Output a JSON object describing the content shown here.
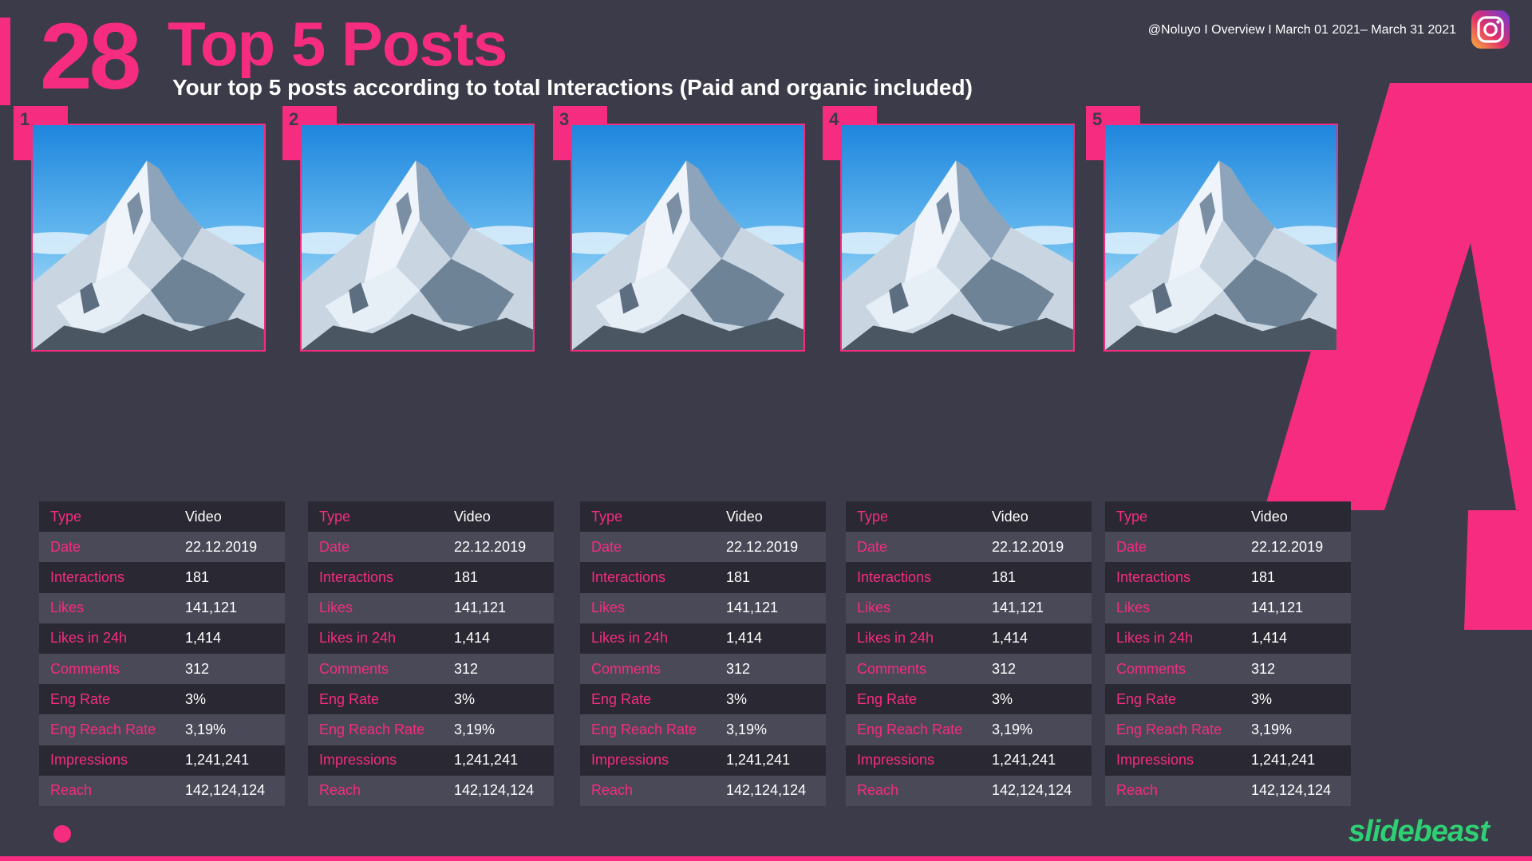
{
  "header": {
    "slide_number": "28",
    "title": "Top 5 Posts",
    "subtitle": "Your top 5 posts according to total Interactions (Paid and organic included)",
    "meta": "@Noluyo I Overview I March 01 2021– March 31 2021"
  },
  "colors": {
    "accent": "#f52c80",
    "background": "#3c3b49",
    "brand": "#2fcf74"
  },
  "icons": {
    "instagram": "instagram-icon"
  },
  "posts": [
    {
      "rank": "1",
      "rows": [
        {
          "label": "Type",
          "value": "Video"
        },
        {
          "label": "Date",
          "value": "22.12.2019"
        },
        {
          "label": "Interactions",
          "value": "181"
        },
        {
          "label": "Likes",
          "value": "141,121"
        },
        {
          "label": "Likes in 24h",
          "value": "1,414"
        },
        {
          "label": "Comments",
          "value": "312"
        },
        {
          "label": "Eng Rate",
          "value": "3%"
        },
        {
          "label": "Eng Reach Rate",
          "value": "3,19%"
        },
        {
          "label": "Impressions",
          "value": "1,241,241"
        },
        {
          "label": "Reach",
          "value": "142,124,124"
        }
      ]
    },
    {
      "rank": "2",
      "rows": [
        {
          "label": "Type",
          "value": "Video"
        },
        {
          "label": "Date",
          "value": "22.12.2019"
        },
        {
          "label": "Interactions",
          "value": "181"
        },
        {
          "label": "Likes",
          "value": "141,121"
        },
        {
          "label": "Likes in 24h",
          "value": "1,414"
        },
        {
          "label": "Comments",
          "value": "312"
        },
        {
          "label": "Eng Rate",
          "value": "3%"
        },
        {
          "label": "Eng Reach Rate",
          "value": "3,19%"
        },
        {
          "label": "Impressions",
          "value": "1,241,241"
        },
        {
          "label": "Reach",
          "value": "142,124,124"
        }
      ]
    },
    {
      "rank": "3",
      "rows": [
        {
          "label": "Type",
          "value": "Video"
        },
        {
          "label": "Date",
          "value": "22.12.2019"
        },
        {
          "label": "Interactions",
          "value": "181"
        },
        {
          "label": "Likes",
          "value": "141,121"
        },
        {
          "label": "Likes in 24h",
          "value": "1,414"
        },
        {
          "label": "Comments",
          "value": "312"
        },
        {
          "label": "Eng Rate",
          "value": "3%"
        },
        {
          "label": "Eng Reach Rate",
          "value": "3,19%"
        },
        {
          "label": "Impressions",
          "value": "1,241,241"
        },
        {
          "label": "Reach",
          "value": "142,124,124"
        }
      ]
    },
    {
      "rank": "4",
      "rows": [
        {
          "label": "Type",
          "value": "Video"
        },
        {
          "label": "Date",
          "value": "22.12.2019"
        },
        {
          "label": "Interactions",
          "value": "181"
        },
        {
          "label": "Likes",
          "value": "141,121"
        },
        {
          "label": "Likes in 24h",
          "value": "1,414"
        },
        {
          "label": "Comments",
          "value": "312"
        },
        {
          "label": "Eng Rate",
          "value": "3%"
        },
        {
          "label": "Eng Reach Rate",
          "value": "3,19%"
        },
        {
          "label": "Impressions",
          "value": "1,241,241"
        },
        {
          "label": "Reach",
          "value": "142,124,124"
        }
      ]
    },
    {
      "rank": "5",
      "rows": [
        {
          "label": "Type",
          "value": "Video"
        },
        {
          "label": "Date",
          "value": "22.12.2019"
        },
        {
          "label": "Interactions",
          "value": "181"
        },
        {
          "label": "Likes",
          "value": "141,121"
        },
        {
          "label": "Likes in 24h",
          "value": "1,414"
        },
        {
          "label": "Comments",
          "value": "312"
        },
        {
          "label": "Eng Rate",
          "value": "3%"
        },
        {
          "label": "Eng Reach Rate",
          "value": "3,19%"
        },
        {
          "label": "Impressions",
          "value": "1,241,241"
        },
        {
          "label": "Reach",
          "value": "142,124,124"
        }
      ]
    }
  ],
  "footer": {
    "brand": "slidebeast"
  }
}
